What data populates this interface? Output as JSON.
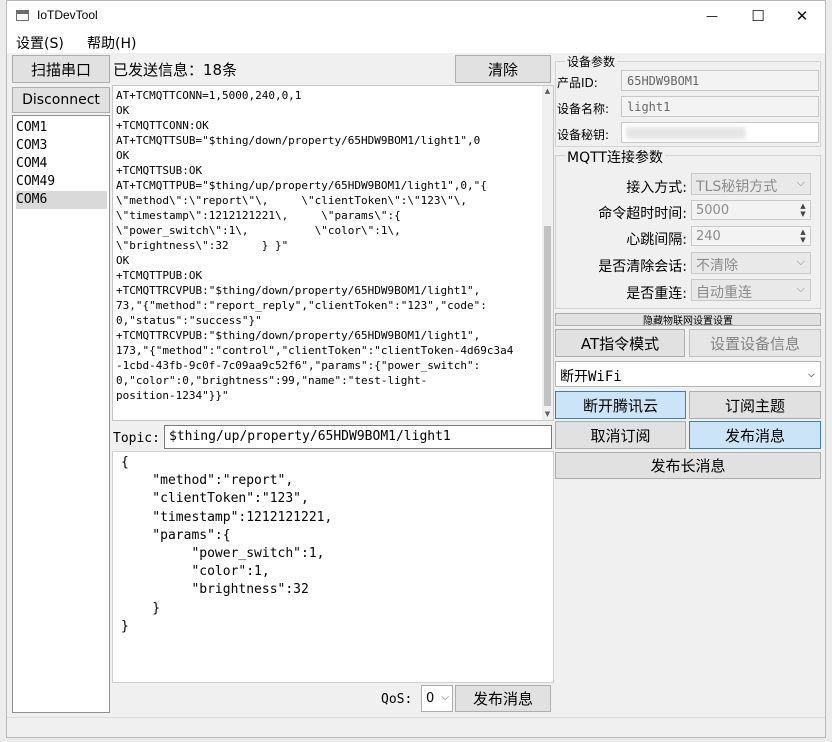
{
  "window": {
    "title": "IoTDevTool",
    "minimize": "—",
    "maximize": "☐",
    "close": "✕"
  },
  "menu": {
    "settings": "设置(S)",
    "help": "帮助(H)"
  },
  "left": {
    "scan_button": "扫描串口",
    "disconnect_button": "Disconnect",
    "ports": [
      "COM1",
      "COM3",
      "COM4",
      "COM49",
      "COM6"
    ],
    "selected_port": "COM6"
  },
  "log": {
    "sent_count": "已发送信息：18条",
    "clear_button": "清除",
    "lines": [
      "AT+TCMQTTCONN=1,5000,240,0,1",
      "OK",
      "+TCMQTTCONN:OK",
      "AT+TCMQTTSUB=\"$thing/down/property/65HDW9BOM1/light1\",0",
      "OK",
      "+TCMQTTSUB:OK",
      "AT+TCMQTTPUB=\"$thing/up/property/65HDW9BOM1/light1\",0,\"{",
      "\\\"method\\\":\\\"report\\\"\\,     \\\"clientToken\\\":\\\"123\\\"\\,",
      "\\\"timestamp\\\":1212121221\\,     \\\"params\\\":{",
      "\\\"power_switch\\\":1\\,          \\\"color\\\":1\\,",
      "\\\"brightness\\\":32     } }\"",
      "OK",
      "+TCMQTTPUB:OK",
      "+TCMQTTRCVPUB:\"$thing/down/property/65HDW9BOM1/light1\",",
      "73,\"{\"method\":\"report_reply\",\"clientToken\":\"123\",\"code\":",
      "0,\"status\":\"success\"}\"",
      "+TCMQTTRCVPUB:\"$thing/down/property/65HDW9BOM1/light1\",",
      "173,\"{\"method\":\"control\",\"clientToken\":\"clientToken-4d69c3a4",
      "-1cbd-43fb-9c0f-7c09aa9c52f6\",\"params\":{\"power_switch\":",
      "0,\"color\":0,\"brightness\":99,\"name\":\"test-light-",
      "position-1234\"}}\""
    ]
  },
  "publish": {
    "topic_label": "Topic:",
    "topic_value": "$thing/up/property/65HDW9BOM1/light1",
    "payload_lines": [
      "{",
      "    \"method\":\"report\",",
      "    \"clientToken\":\"123\",",
      "    \"timestamp\":1212121221,",
      "    \"params\":{",
      "         \"power_switch\":1,",
      "         \"color\":1,",
      "         \"brightness\":32",
      "    }",
      "}"
    ],
    "qos_label": "QoS:",
    "qos_value": "0",
    "publish_button": "发布消息"
  },
  "device": {
    "group_title": "设备参数",
    "product_id_label": "产品ID:",
    "product_id_value": "65HDW9BOM1",
    "device_name_label": "设备名称:",
    "device_name_value": "light1",
    "device_secret_label": "设备秘钥:"
  },
  "mqtt": {
    "group_title": "MQTT连接参数",
    "access_label": "接入方式:",
    "access_value": "TLS秘钥方式",
    "timeout_label": "命令超时时间:",
    "timeout_value": "5000",
    "heartbeat_label": "心跳间隔:",
    "heartbeat_value": "240",
    "clean_session_label": "是否清除会话:",
    "clean_session_value": "不清除",
    "reconnect_label": "是否重连:",
    "reconnect_value": "自动重连"
  },
  "actions": {
    "hide_settings": "隐藏物联网设置设置",
    "at_mode": "AT指令模式",
    "set_device_info": "设置设备信息",
    "wifi_select": "断开WiFi",
    "disconnect_cloud": "断开腾讯云",
    "subscribe": "订阅主题",
    "unsubscribe": "取消订阅",
    "publish": "发布消息",
    "publish_long": "发布长消息"
  }
}
